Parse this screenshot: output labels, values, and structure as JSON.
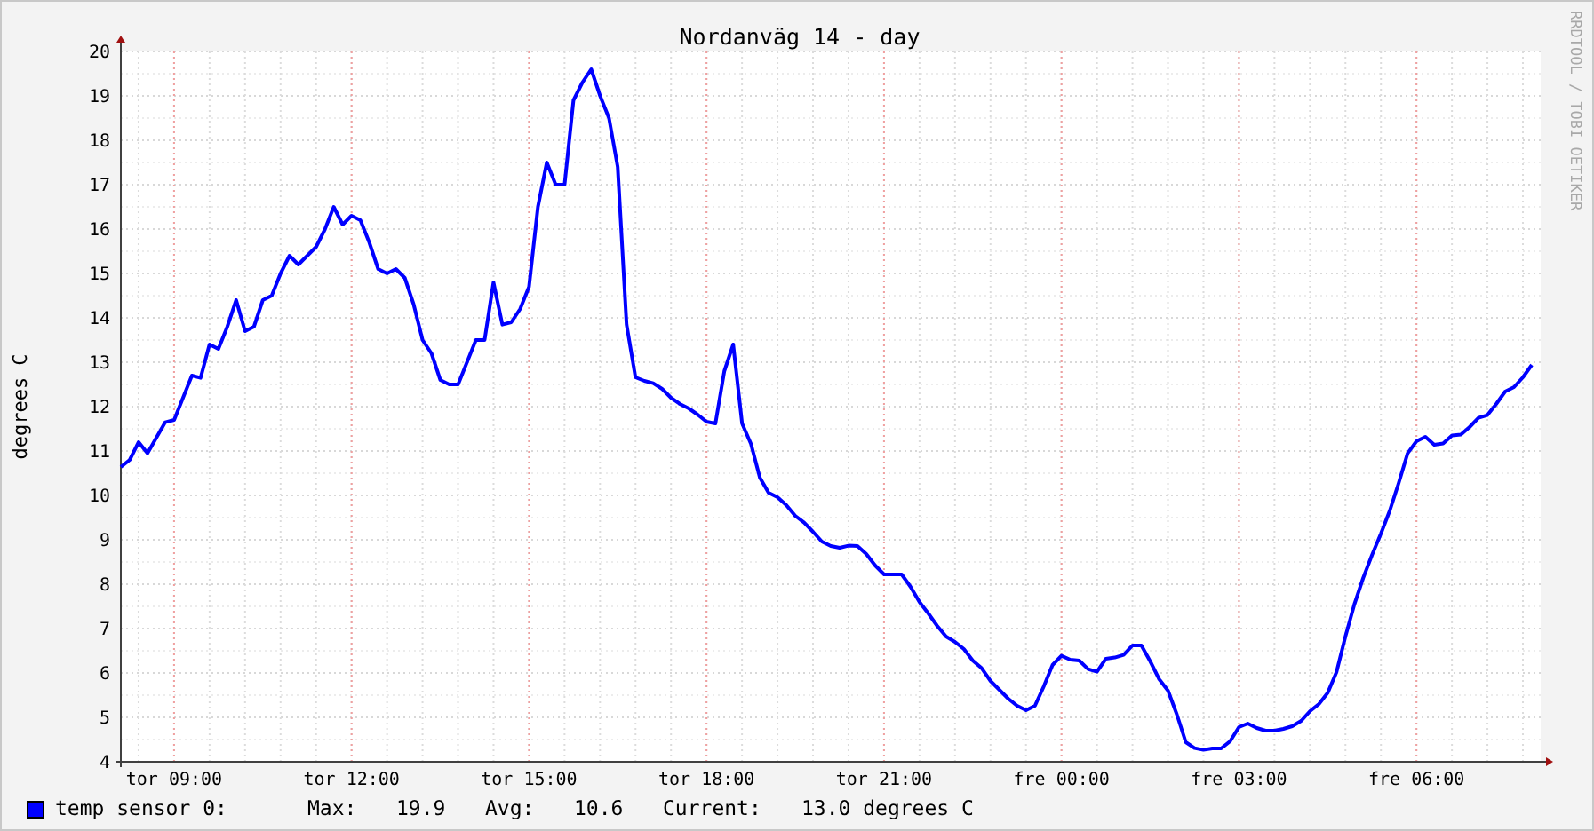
{
  "graph": {
    "title": "Nordanväg 14 - day",
    "credit": "RRDTOOL / TOBI OETIKER",
    "chart_data": {
      "type": "line",
      "grid": true,
      "ylabel": "degrees C",
      "ylim": [
        4,
        20
      ],
      "yticks": [
        4,
        5,
        6,
        7,
        8,
        9,
        10,
        11,
        12,
        13,
        14,
        15,
        16,
        17,
        18,
        19,
        20
      ],
      "categories": [
        null,
        null,
        null,
        null,
        null,
        null,
        "tor 09:00",
        null,
        null,
        null,
        null,
        null,
        null,
        null,
        null,
        null,
        null,
        null,
        null,
        null,
        null,
        null,
        null,
        null,
        null,
        null,
        "tor 12:00",
        null,
        null,
        null,
        null,
        null,
        null,
        null,
        null,
        null,
        null,
        null,
        null,
        null,
        null,
        null,
        null,
        null,
        null,
        null,
        "tor 15:00",
        null,
        null,
        null,
        null,
        null,
        null,
        null,
        null,
        null,
        null,
        null,
        null,
        null,
        null,
        null,
        null,
        null,
        null,
        null,
        "tor 18:00",
        null,
        null,
        null,
        null,
        null,
        null,
        null,
        null,
        null,
        null,
        null,
        null,
        null,
        null,
        null,
        null,
        null,
        null,
        null,
        "tor 21:00",
        null,
        null,
        null,
        null,
        null,
        null,
        null,
        null,
        null,
        null,
        null,
        null,
        null,
        null,
        null,
        null,
        null,
        null,
        null,
        "fre 00:00",
        null,
        null,
        null,
        null,
        null,
        null,
        null,
        null,
        null,
        null,
        null,
        null,
        null,
        null,
        null,
        null,
        null,
        null,
        null,
        "fre 03:00",
        null,
        null,
        null,
        null,
        null,
        null,
        null,
        null,
        null,
        null,
        null,
        null,
        null,
        null,
        null,
        null,
        null,
        null,
        null,
        "fre 06:00",
        null,
        null,
        null,
        null,
        null,
        null,
        null,
        null,
        null,
        null,
        null,
        null,
        null
      ],
      "series": [
        {
          "name": "temp sensor 0:",
          "color": "#0000ff",
          "values": [
            10.64,
            10.8,
            11.2,
            10.95,
            11.3,
            11.65,
            11.7,
            12.2,
            12.7,
            12.65,
            13.4,
            13.3,
            13.8,
            14.4,
            13.7,
            13.8,
            14.4,
            14.5,
            15.0,
            15.4,
            15.2,
            15.4,
            15.6,
            16.0,
            16.5,
            16.1,
            16.3,
            16.2,
            15.7,
            15.1,
            15.0,
            15.1,
            14.9,
            14.3,
            13.5,
            13.2,
            12.6,
            12.5,
            12.5,
            13.0,
            13.5,
            13.5,
            14.8,
            13.85,
            13.9,
            14.2,
            14.7,
            16.5,
            17.5,
            17.0,
            17.0,
            18.9,
            19.3,
            19.6,
            19.0,
            18.5,
            17.4,
            13.85,
            12.66,
            12.58,
            12.53,
            12.4,
            12.2,
            12.06,
            11.96,
            11.82,
            11.66,
            11.62,
            12.8,
            13.4,
            11.62,
            11.16,
            10.4,
            10.06,
            9.96,
            9.78,
            9.54,
            9.39,
            9.18,
            8.96,
            8.86,
            8.82,
            8.87,
            8.86,
            8.68,
            8.42,
            8.22,
            8.22,
            8.22,
            7.94,
            7.6,
            7.34,
            7.06,
            6.82,
            6.7,
            6.54,
            6.28,
            6.11,
            5.82,
            5.62,
            5.42,
            5.26,
            5.16,
            5.26,
            5.7,
            6.18,
            6.39,
            6.3,
            6.28,
            6.09,
            6.03,
            6.32,
            6.35,
            6.41,
            6.62,
            6.62,
            6.26,
            5.86,
            5.6,
            5.06,
            4.44,
            4.31,
            4.27,
            4.3,
            4.3,
            4.46,
            4.78,
            4.86,
            4.76,
            4.7,
            4.7,
            4.74,
            4.8,
            4.92,
            5.14,
            5.3,
            5.55,
            6.02,
            6.82,
            7.54,
            8.14,
            8.66,
            9.14,
            9.66,
            10.28,
            10.95,
            11.22,
            11.32,
            11.14,
            11.17,
            11.35,
            11.37,
            11.54,
            11.75,
            11.81,
            12.06,
            12.34,
            12.44,
            12.66,
            12.94
          ]
        }
      ]
    }
  },
  "legend": [
    {
      "color": "#0000ff",
      "stats": [
        {
          "label": "Max:",
          "value": "19.9"
        },
        {
          "label": "Avg:",
          "value": "10.6"
        },
        {
          "label": "Current:",
          "value": "13.0 degrees C"
        }
      ]
    }
  ]
}
